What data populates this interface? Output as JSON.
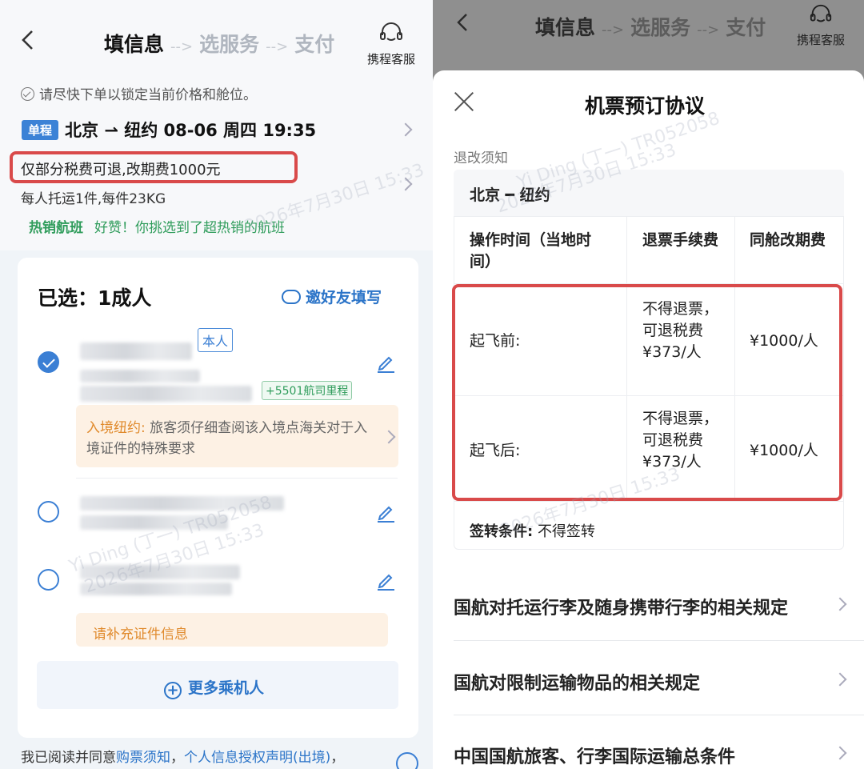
{
  "left": {
    "header": {
      "step1": "填信息",
      "step2": "选服务",
      "step3": "支付",
      "arrow": "-->",
      "service_label": "携程客服"
    },
    "tip": "请尽快下单以锁定当前价格和舱位。",
    "flight": {
      "badge": "单程",
      "route": "北京 ⇀ 纽约 08-06 周四 19:35"
    },
    "fee_note": "仅部分税费可退,改期费1000元",
    "baggage_note": "每人托运1件,每件23KG",
    "hot": {
      "label": "热销航班",
      "text": "好赞！你挑选到了超热销的航班"
    },
    "passengers": {
      "title": "已选：1成人",
      "invite": "邀好友填写",
      "self_tag": "本人",
      "miles_tag": "+5501航司里程",
      "entry_label": "入境纽约:",
      "entry_text": "旅客须仔细查阅该入境点海关对于入境证件的特殊要求",
      "id_note": "请补充证件信息",
      "more_button": "更多乘机人"
    },
    "agreement": {
      "prefix": "我已阅读并同意",
      "link1": "购票须知",
      "sep": "，",
      "link2": "个人信息授权声明(出境)",
      "suffix": "，"
    }
  },
  "right": {
    "header": {
      "step1": "填信息",
      "step2": "选服务",
      "step3": "支付",
      "arrow": "-->",
      "service_label": "携程客服"
    },
    "sheet": {
      "title": "机票预订协议",
      "section_label": "退改须知",
      "route": "北京 ━ 纽约",
      "columns": [
        "操作时间（当地时间）",
        "退票手续费",
        "同舱改期费"
      ],
      "rows": [
        {
          "time": "起飞前:",
          "refund": "不得退票，可退税费¥373/人",
          "change": "¥1000/人"
        },
        {
          "time": "起飞后:",
          "refund": "不得退票，可退税费¥373/人",
          "change": "¥1000/人"
        }
      ],
      "endorse_label": "签转条件:",
      "endorse_value": "不得签转",
      "rules": [
        "国航对托运行李及随身携带行李的相关规定",
        "国航对限制运输物品的相关规定",
        "中国国航旅客、行李国际运输总条件"
      ]
    }
  },
  "watermark": {
    "name": "Yi Ding (丁一) TR052058",
    "date": "2026年7月30日 15:33"
  },
  "colors": {
    "brand_blue": "#2b74c8",
    "highlight_red": "#d94a4a",
    "hot_green": "#2f9c5b",
    "warn_orange": "#e08a2c"
  }
}
